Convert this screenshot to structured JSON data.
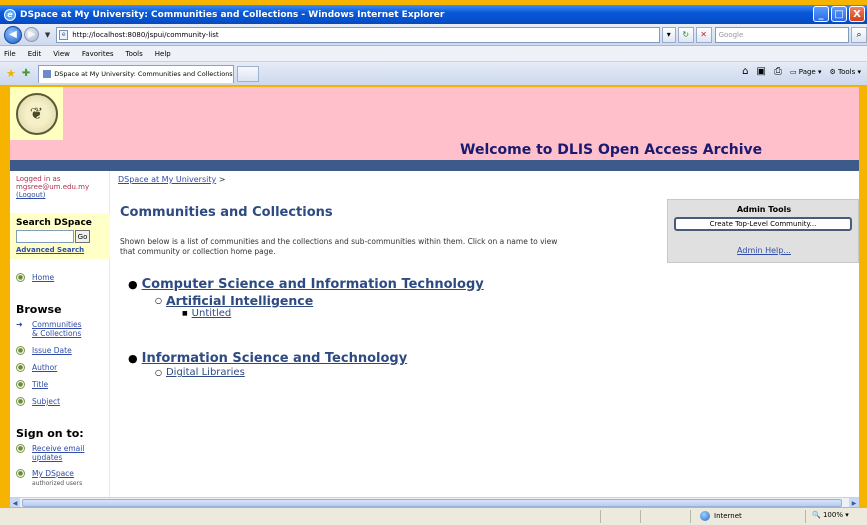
{
  "window": {
    "title": "DSpace at My University: Communities and Collections - Windows Internet Explorer",
    "controls": [
      "_",
      "□",
      "X"
    ]
  },
  "address": {
    "url": "http://localhost:8080/jspui/community-list",
    "search_placeholder": "Google"
  },
  "menu": [
    "File",
    "Edit",
    "View",
    "Favorites",
    "Tools",
    "Help"
  ],
  "tab": {
    "title": "DSpace at My University: Communities and Collections"
  },
  "command_bar": {
    "page": "Page",
    "tools": "Tools"
  },
  "banner": {
    "welcome": "Welcome to DLIS Open Access Archive"
  },
  "sidebar": {
    "logged_in_line1": "Logged in as",
    "logged_in_user": "mgsree@um.edu.my",
    "logout": "(Logout)",
    "search_heading": "Search DSpace",
    "go_label": "Go",
    "advanced_search": "Advanced Search",
    "home": "Home",
    "browse_heading": "Browse",
    "communities_line1": "Communities",
    "communities_line2": "& Collections",
    "issue_date": "Issue Date",
    "author": "Author",
    "title": "Title",
    "subject": "Subject",
    "signon_heading": "Sign on to:",
    "receive_line1": "Receive email",
    "receive_line2": "updates",
    "my_dspace": "My DSpace",
    "authorized": "authorized users"
  },
  "main": {
    "breadcrumb_link": "DSpace at My University",
    "breadcrumb_sep": ">",
    "title": "Communities and Collections",
    "intro_line1": "Shown below is a list of communities and the collections and sub-communities within them. Click on a name to view",
    "intro_line2": "that community or collection home page.",
    "tree": {
      "c1": "Computer Science and Information Technology",
      "c1_sub": "Artificial Intelligence",
      "c1_sub_col": "Untitled",
      "c2": "Information Science and Technology",
      "c2_col": "Digital Libraries"
    }
  },
  "admin": {
    "heading": "Admin Tools",
    "create_button": "Create Top-Level Community...",
    "help": "Admin Help..."
  },
  "status": {
    "zone": "Internet",
    "zoom": "100%"
  }
}
